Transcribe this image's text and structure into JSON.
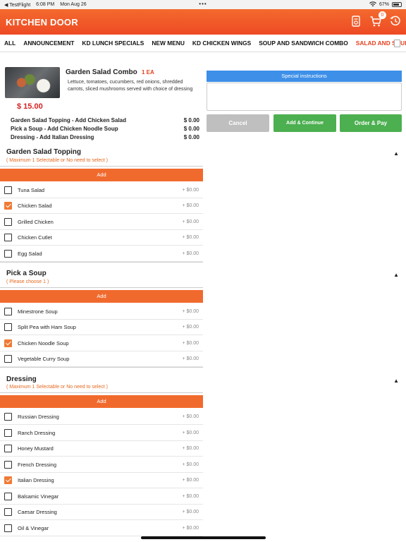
{
  "status_bar": {
    "back": "◀ TestFlight",
    "time": "6:08 PM",
    "date": "Mon Aug 26",
    "dots": "•••",
    "wifi": "⇡",
    "battery": "67%"
  },
  "header": {
    "title": "KITCHEN DOOR",
    "cart_count": "0"
  },
  "tabs": [
    {
      "label": "ALL"
    },
    {
      "label": "ANNOUNCEMENT"
    },
    {
      "label": "KD LUNCH SPECIALS"
    },
    {
      "label": "NEW MENU"
    },
    {
      "label": "KD CHICKEN WINGS"
    },
    {
      "label": "SOUP AND SANDWICH COMBO"
    },
    {
      "label": "SALAD AND SOUP CO",
      "active": true
    }
  ],
  "product": {
    "name": "Garden Salad Combo",
    "qty": "1 EA",
    "description": "Lettuce, tomatoes, cucumbers, red onions, shredded carrots, sliced mushrooms served with choice of dressing",
    "price": "$ 15.00"
  },
  "selections": [
    {
      "label": "Garden Salad Topping - Add Chicken Salad",
      "price": "$ 0.00"
    },
    {
      "label": "Pick a Soup - Add Chicken Noodle Soup",
      "price": "$ 0.00"
    },
    {
      "label": "Dressing - Add Italian Dressing",
      "price": "$ 0.00"
    }
  ],
  "sections": [
    {
      "title": "Garden Salad Topping",
      "subtitle": "( Maximum 1 Selectable or No need to select )",
      "caret": "▲",
      "add_label": "Add",
      "options": [
        {
          "label": "Tuna Salad",
          "price": "+ $0.00",
          "checked": false
        },
        {
          "label": "Chicken Salad",
          "price": "+ $0.00",
          "checked": true
        },
        {
          "label": "Grilled Chicken",
          "price": "+ $0.00",
          "checked": false
        },
        {
          "label": "Chicken Cutlet",
          "price": "+ $0.00",
          "checked": false
        },
        {
          "label": "Egg Salad",
          "price": "+ $0.00",
          "checked": false
        }
      ]
    },
    {
      "title": "Pick a Soup",
      "subtitle": "( Please choose 1 )",
      "caret": "▲",
      "add_label": "Add",
      "options": [
        {
          "label": "Minestrone Soup",
          "price": "+ $0.00",
          "checked": false
        },
        {
          "label": "Split Pea with Ham Soup",
          "price": "+ $0.00",
          "checked": false
        },
        {
          "label": "Chicken Noodle Soup",
          "price": "+ $0.00",
          "checked": true
        },
        {
          "label": "Vegetable Curry Soup",
          "price": "+ $0.00",
          "checked": false
        }
      ]
    },
    {
      "title": "Dressing",
      "subtitle": "( Maximum 1 Selectable or No need to select )",
      "caret": "▲",
      "add_label": "Add",
      "options": [
        {
          "label": "Russian Dressing",
          "price": "+ $0.00",
          "checked": false
        },
        {
          "label": "Ranch Dressing",
          "price": "+ $0.00",
          "checked": false
        },
        {
          "label": "Honey Mustard",
          "price": "+ $0.00",
          "checked": false
        },
        {
          "label": "French Dressing",
          "price": "+ $0.00",
          "checked": false
        },
        {
          "label": "Italian Dressing",
          "price": "+ $0.00",
          "checked": true
        },
        {
          "label": "Balsamic Vinegar",
          "price": "+ $0.00",
          "checked": false
        },
        {
          "label": "Caesar Dressing",
          "price": "+ $0.00",
          "checked": false
        },
        {
          "label": "Oil & Vinegar",
          "price": "+ $0.00",
          "checked": false
        }
      ]
    }
  ],
  "instructions": {
    "label": "Special instructions",
    "value": ""
  },
  "buttons": {
    "cancel": "Cancel",
    "add_continue": "Add & Continue",
    "order_pay": "Order & Pay"
  },
  "colors": {
    "brand": "#ee4a24",
    "accent_blue": "#3d8fe8",
    "green": "#4caf50",
    "grey": "#bfbfbf"
  }
}
